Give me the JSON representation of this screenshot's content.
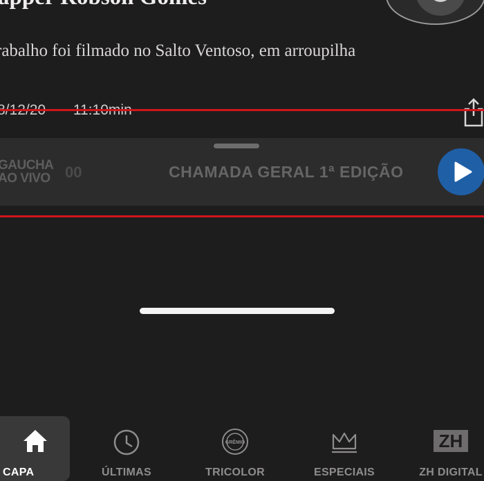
{
  "article": {
    "headline": "apper Robson Gomes",
    "summary": "rabalho foi filmado no Salto Ventoso, em arroupilha",
    "date": "8/12/20",
    "time": "11:10min"
  },
  "player": {
    "station_line1": "GAUCHA",
    "station_line2": "AO VIVO",
    "previous_program": "00",
    "program": "CHAMADA GERAL 1ª EDIÇÃO",
    "accent": "#1f5fa6"
  },
  "tabs": {
    "capa": "CAPA",
    "ultimas": "ÚLTIMAS",
    "tricolor": "TRICOLOR",
    "especiais": "ESPECIAIS",
    "zh_digital": "ZH DIGITAL",
    "grem_badge": "GRÊMIO",
    "zh_logo": "ZH"
  },
  "colors": {
    "background": "#1e1d1d",
    "highlight_line": "#d2141c"
  }
}
